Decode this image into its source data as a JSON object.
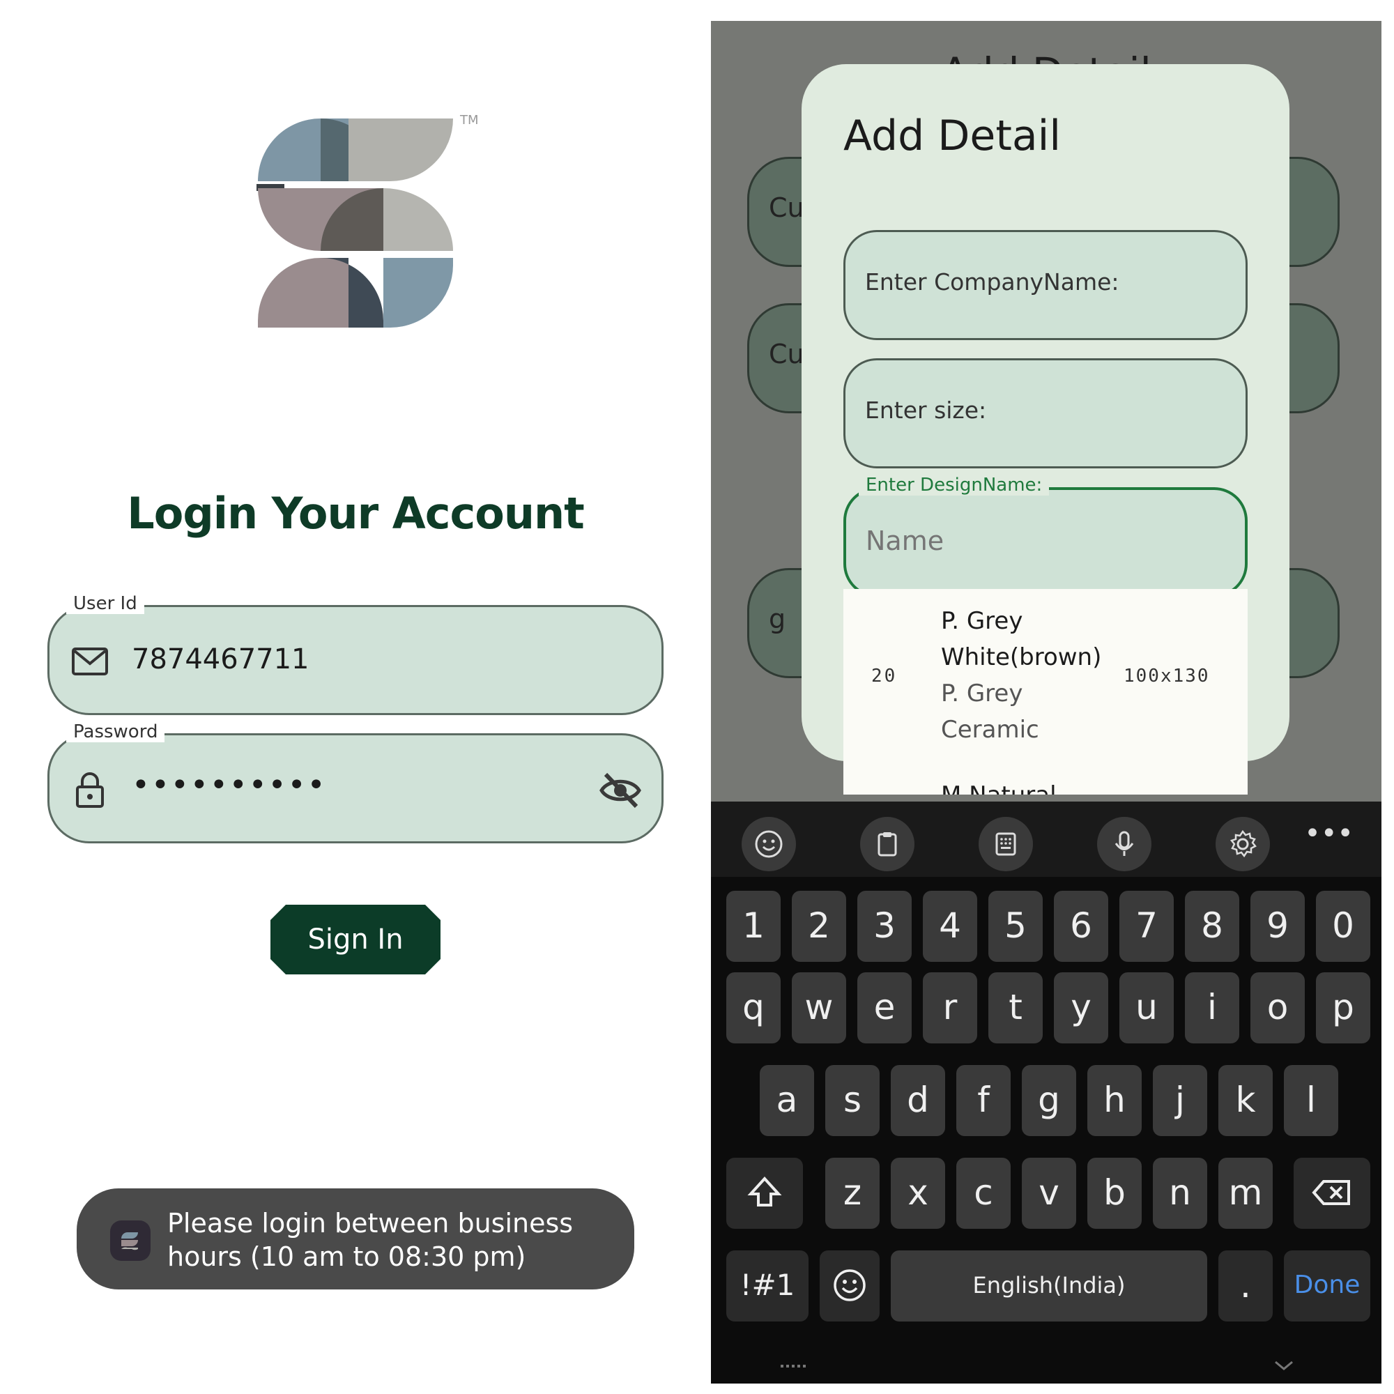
{
  "login": {
    "title": "Login Your Account",
    "user_label": "User Id",
    "user_value": "7874467711",
    "password_label": "Password",
    "password_value": "••••••••••",
    "signin_label": "Sign In",
    "toast_text": "Please login between business hours (10 am to 08:30 pm)",
    "logo_tm": "TM"
  },
  "background": {
    "title": "Add Detail",
    "pill1": "Cu",
    "pill2": "Cu",
    "pill3": "g"
  },
  "dialog": {
    "title": "Add Detail",
    "company_placeholder": "Enter CompanyName:",
    "size_placeholder": "Enter size:",
    "design_label": "Enter DesignName:",
    "design_placeholder": "Name"
  },
  "dropdown": {
    "item_number": "20",
    "item_name": "P. Grey White(brown)",
    "item_sub": "P. Grey Ceramic",
    "item_size": "100x130",
    "next_item": "M Natural"
  },
  "keyboard": {
    "row_numbers": [
      "1",
      "2",
      "3",
      "4",
      "5",
      "6",
      "7",
      "8",
      "9",
      "0"
    ],
    "row1": [
      "q",
      "w",
      "e",
      "r",
      "t",
      "y",
      "u",
      "i",
      "o",
      "p"
    ],
    "row2": [
      "a",
      "s",
      "d",
      "f",
      "g",
      "h",
      "j",
      "k",
      "l"
    ],
    "row3": [
      "z",
      "x",
      "c",
      "v",
      "b",
      "n",
      "m"
    ],
    "symbols_label": "!#1",
    "space_label": "English(India)",
    "period_label": ".",
    "done_label": "Done",
    "toolbar_icons": [
      "emoji-icon",
      "clipboard-icon",
      "keypad-icon",
      "microphone-icon",
      "settings-icon"
    ],
    "done_color": "#4a8fe8"
  },
  "colors": {
    "brand_dark_green": "#0c3c28",
    "field_fill": "#d0e2d8",
    "focus_green": "#1f7a3d"
  }
}
